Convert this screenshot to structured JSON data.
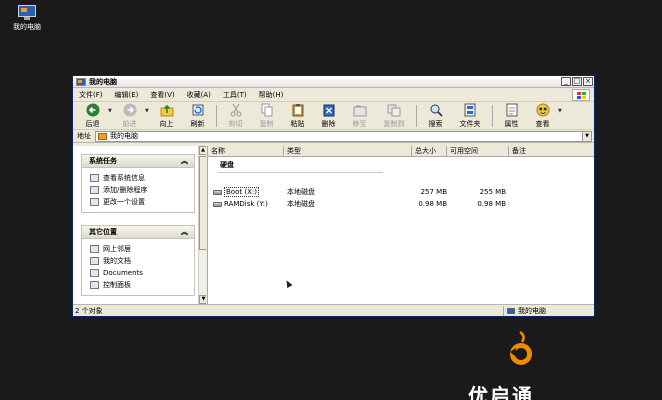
{
  "desktop": {
    "icon_label": "我的电脑"
  },
  "window": {
    "title": "我的电脑",
    "menu": [
      "文件(F)",
      "编辑(E)",
      "查看(V)",
      "收藏(A)",
      "工具(T)",
      "帮助(H)"
    ],
    "toolbar": {
      "back": "后退",
      "forward": "前进",
      "up": "向上",
      "refresh": "刷新",
      "cut": "剪切",
      "copy": "复制",
      "paste": "粘贴",
      "delete": "删除",
      "move_to": "移至",
      "copy_to": "复制到",
      "search": "搜索",
      "folders": "文件夹",
      "properties": "属性",
      "view": "查看"
    },
    "address": {
      "label": "地址",
      "value": "我的电脑"
    },
    "tasks": {
      "system": {
        "title": "系统任务",
        "items": [
          "查看系统信息",
          "添加/删除程序",
          "更改一个设置"
        ]
      },
      "other": {
        "title": "其它位置",
        "items": [
          "网上邻居",
          "我的文档",
          "Documents",
          "控制面板"
        ]
      }
    },
    "columns": {
      "name": "名称",
      "type": "类型",
      "total": "总大小",
      "free": "可用空间",
      "notes": "备注"
    },
    "group": "硬盘",
    "drives": [
      {
        "name": "Boot (X:)",
        "type": "本地磁盘",
        "total": "257 MB",
        "free": "255 MB"
      },
      {
        "name": "RAMDisk (Y:)",
        "type": "本地磁盘",
        "total": "0.98 MB",
        "free": "0.98 MB"
      }
    ],
    "status": {
      "count": "2 个对象",
      "location": "我的电脑"
    }
  },
  "logo": {
    "text": "优启通"
  },
  "colors": {
    "desktop": "#1a1a1a",
    "window_face": "#ece9d8",
    "logo_orange": "#f08a00"
  }
}
